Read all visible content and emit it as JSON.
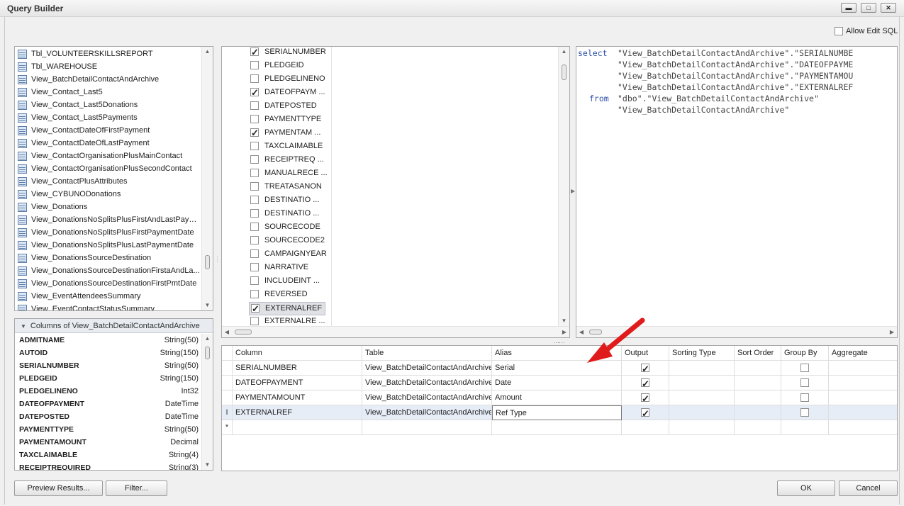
{
  "window": {
    "title": "Query Builder",
    "buttons": {
      "minimize": "▬",
      "restore": "□",
      "close": "✕"
    }
  },
  "allow_edit_sql": {
    "label": "Allow Edit SQL",
    "checked": false
  },
  "tables": [
    "Tbl_VOLUNTEERSKILLSREPORT",
    "Tbl_WAREHOUSE",
    "View_BatchDetailContactAndArchive",
    "View_Contact_Last5",
    "View_Contact_Last5Donations",
    "View_Contact_Last5Payments",
    "View_ContactDateOfFirstPayment",
    "View_ContactDateOfLastPayment",
    "View_ContactOrganisationPlusMainContact",
    "View_ContactOrganisationPlusSecondContact",
    "View_ContactPlusAttributes",
    "View_CYBUNODonations",
    "View_Donations",
    "View_DonationsNoSplitsPlusFirstAndLastPaym...",
    "View_DonationsNoSplitsPlusFirstPaymentDate",
    "View_DonationsNoSplitsPlusLastPaymentDate",
    "View_DonationsSourceDestination",
    "View_DonationsSourceDestinationFirstaAndLa...",
    "View_DonationsSourceDestinationFirstPmtDate",
    "View_EventAttendeesSummary",
    "View_EventContactStatusSummary"
  ],
  "columns_panel": {
    "title": "Columns of View_BatchDetailContactAndArchive",
    "rows": [
      {
        "name": "ADMITNAME",
        "type": "String(50)"
      },
      {
        "name": "AUTOID",
        "type": "String(150)"
      },
      {
        "name": "SERIALNUMBER",
        "type": "String(50)"
      },
      {
        "name": "PLEDGEID",
        "type": "String(150)"
      },
      {
        "name": "PLEDGELINENO",
        "type": "Int32"
      },
      {
        "name": "DATEOFPAYMENT",
        "type": "DateTime"
      },
      {
        "name": "DATEPOSTED",
        "type": "DateTime"
      },
      {
        "name": "PAYMENTTYPE",
        "type": "String(50)"
      },
      {
        "name": "PAYMENTAMOUNT",
        "type": "Decimal"
      },
      {
        "name": "TAXCLAIMABLE",
        "type": "String(4)"
      },
      {
        "name": "RECEIPTREQUIRED",
        "type": "String(3)"
      }
    ]
  },
  "fields": [
    {
      "label": "SERIALNUMBER",
      "checked": true
    },
    {
      "label": "PLEDGEID",
      "checked": false
    },
    {
      "label": "PLEDGELINENO",
      "checked": false
    },
    {
      "label": "DATEOFPAYM ...",
      "checked": true
    },
    {
      "label": "DATEPOSTED",
      "checked": false
    },
    {
      "label": "PAYMENTTYPE",
      "checked": false
    },
    {
      "label": "PAYMENTAM ...",
      "checked": true
    },
    {
      "label": "TAXCLAIMABLE",
      "checked": false
    },
    {
      "label": "RECEIPTREQ ...",
      "checked": false
    },
    {
      "label": "MANUALRECE ...",
      "checked": false
    },
    {
      "label": "TREATASANON",
      "checked": false
    },
    {
      "label": "DESTINATIO ...",
      "checked": false
    },
    {
      "label": "DESTINATIO ...",
      "checked": false
    },
    {
      "label": "SOURCECODE",
      "checked": false
    },
    {
      "label": "SOURCECODE2",
      "checked": false
    },
    {
      "label": "CAMPAIGNYEAR",
      "checked": false
    },
    {
      "label": "NARRATIVE",
      "checked": false
    },
    {
      "label": "INCLUDEINT ...",
      "checked": false
    },
    {
      "label": "REVERSED",
      "checked": false
    },
    {
      "label": "EXTERNALREF",
      "checked": true,
      "selected": true
    },
    {
      "label": "EXTERNALRE ...",
      "checked": false
    }
  ],
  "sql": {
    "select_kw": "select",
    "from_kw": "from",
    "lines": [
      "\"View_BatchDetailContactAndArchive\".\"SERIALNUMBE",
      "\"View_BatchDetailContactAndArchive\".\"DATEOFPAYME",
      "\"View_BatchDetailContactAndArchive\".\"PAYMENTAMOU",
      "\"View_BatchDetailContactAndArchive\".\"EXTERNALREF",
      "\"dbo\".\"View_BatchDetailContactAndArchive\"",
      "\"View_BatchDetailContactAndArchive\""
    ]
  },
  "grid": {
    "headers": [
      "Column",
      "Table",
      "Alias",
      "Output",
      "Sorting Type",
      "Sort Order",
      "Group By",
      "Aggregate"
    ],
    "rows": [
      {
        "column": "SERIALNUMBER",
        "table": "View_BatchDetailContactAndArchive",
        "alias": "Serial",
        "output": true,
        "group_by": false
      },
      {
        "column": "DATEOFPAYMENT",
        "table": "View_BatchDetailContactAndArchive",
        "alias": "Date",
        "output": true,
        "group_by": false
      },
      {
        "column": "PAYMENTAMOUNT",
        "table": "View_BatchDetailContactAndArchive",
        "alias": "Amount",
        "output": true,
        "group_by": false
      },
      {
        "column": "EXTERNALREF",
        "table": "View_BatchDetailContactAndArchive",
        "alias": "Ref Type",
        "output": true,
        "group_by": false,
        "editing": true
      }
    ],
    "edit_marker": "I",
    "new_row_marker": "*"
  },
  "buttons": {
    "preview": "Preview Results...",
    "filter": "Filter...",
    "ok": "OK",
    "cancel": "Cancel"
  },
  "colors": {
    "arrow": "#e01b1b",
    "sql_keyword": "#2a4fa8"
  }
}
